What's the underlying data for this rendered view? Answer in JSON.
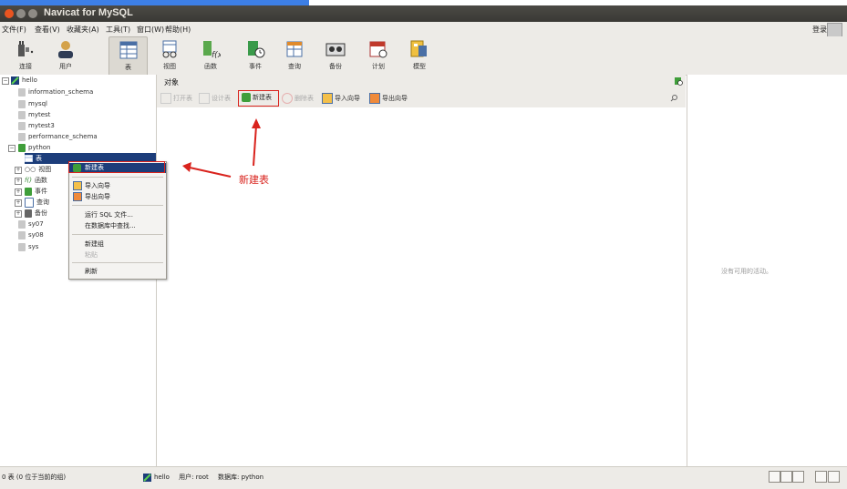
{
  "window": {
    "title": "Navicat for MySQL"
  },
  "menu": [
    {
      "label": "文件(F)"
    },
    {
      "label": "查看(V)"
    },
    {
      "label": "收藏夹(A)"
    },
    {
      "label": "工具(T)"
    },
    {
      "label": "窗口(W)"
    },
    {
      "label": "帮助(H)"
    }
  ],
  "login": "登录",
  "toolbar": [
    {
      "label": "连接",
      "icon": "plug-icon"
    },
    {
      "label": "用户",
      "icon": "user-icon"
    },
    {
      "label": "表",
      "icon": "table-icon"
    },
    {
      "label": "视图",
      "icon": "view-icon"
    },
    {
      "label": "函数",
      "icon": "function-icon"
    },
    {
      "label": "事件",
      "icon": "event-icon"
    },
    {
      "label": "查询",
      "icon": "query-icon"
    },
    {
      "label": "备份",
      "icon": "backup-icon"
    },
    {
      "label": "计划",
      "icon": "schedule-icon"
    },
    {
      "label": "模型",
      "icon": "model-icon"
    }
  ],
  "tree": {
    "connection": "hello",
    "databases": [
      "information_schema",
      "mysql",
      "mytest",
      "mytest3",
      "performance_schema",
      "python"
    ],
    "python_children": [
      "表",
      "视图",
      "函数",
      "事件",
      "查询",
      "备份"
    ],
    "other_dbs": [
      "sy07",
      "sy08",
      "sys"
    ]
  },
  "objects_tab": "对象",
  "object_toolbar": [
    "打开表",
    "设计表",
    "新建表",
    "删除表",
    "导入向导",
    "导出向导"
  ],
  "context_menu": {
    "items": [
      "新建表",
      "导入向导",
      "导出向导",
      "运行 SQL 文件...",
      "在数据库中查找...",
      "新建组",
      "粘贴",
      "刷新"
    ]
  },
  "annotation": "新建表",
  "right_panel": {
    "no_activity": "没有可用的活动。"
  },
  "status": {
    "left": "0 表 (0 位于当前的组)",
    "connection": "hello",
    "user": "用户: root",
    "database": "数据库: python"
  },
  "colors": {
    "accent": "#d9231d",
    "selection": "#1c3d7a",
    "chrome": "#edebe7"
  }
}
